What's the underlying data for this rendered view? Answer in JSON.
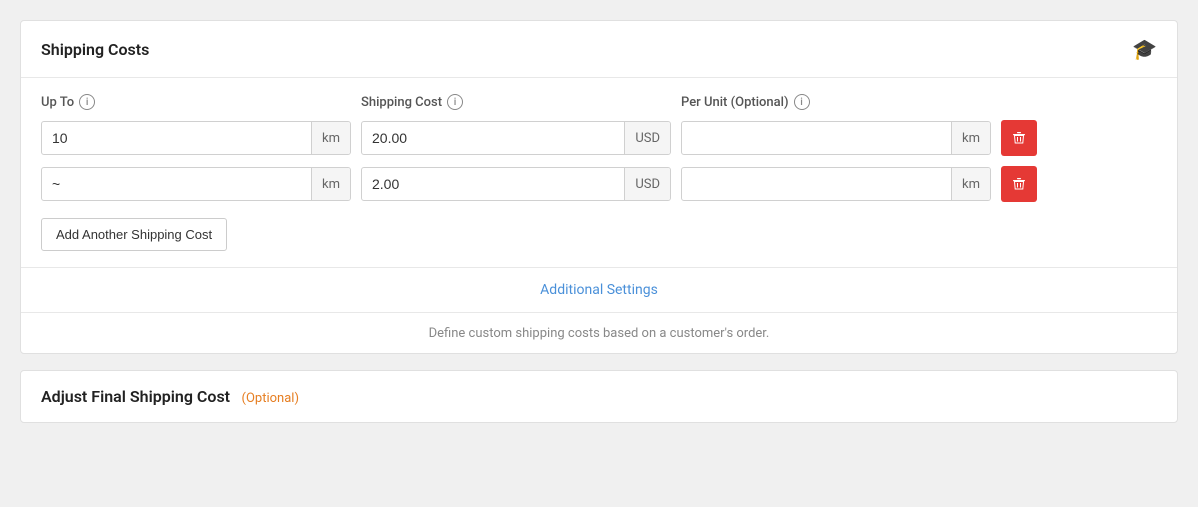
{
  "shippingCosts": {
    "title": "Shipping Costs",
    "gradIcon": "🎓",
    "columns": {
      "upTo": "Up To",
      "shippingCost": "Shipping Cost",
      "perUnit": "Per Unit (Optional)"
    },
    "rows": [
      {
        "upToValue": "10",
        "upToSuffix": "km",
        "shippingCostValue": "20.00",
        "shippingCostSuffix": "USD",
        "perUnitValue": "",
        "perUnitSuffix": "km"
      },
      {
        "upToValue": "~",
        "upToSuffix": "km",
        "shippingCostValue": "2.00",
        "shippingCostSuffix": "USD",
        "perUnitValue": "",
        "perUnitSuffix": "km"
      }
    ],
    "addButtonLabel": "Add Another Shipping Cost",
    "additionalSettingsLabel": "Additional Settings",
    "descriptionText": "Define custom shipping costs based on a customer's order."
  },
  "adjustFinalShipping": {
    "title": "Adjust Final Shipping Cost",
    "optionalLabel": "(Optional)"
  }
}
